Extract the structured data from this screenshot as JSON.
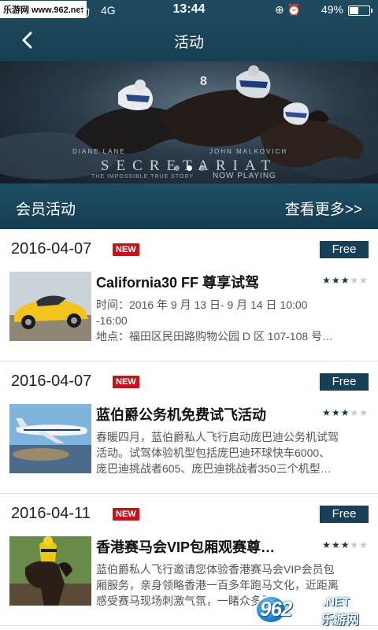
{
  "status_bar": {
    "watermark": "乐游网 www.962.net",
    "carrier": "动",
    "network": "4G",
    "time": "13:44",
    "icons": "⊕ ⏰",
    "battery": "49%",
    "battery_level": 0.49
  },
  "nav": {
    "back_icon": "chevron-left-icon",
    "title": "活动"
  },
  "banner": {
    "credit_left": "DIANE LANE",
    "credit_right": "JOHN MALKOVICH",
    "movie_title": "SECRETARIAT",
    "tagline": "THE IMPOSSIBLE TRUE STORY",
    "now_playing": "NOW PLAYING",
    "page_count": 3,
    "active_page": 2
  },
  "section": {
    "label": "会员活动",
    "more": "查看更多>>"
  },
  "activities": [
    {
      "date": "2016-04-07",
      "new_badge": "NEW",
      "price": "Free",
      "name": "California30 FF 尊享试驾",
      "rating": 3,
      "rating_max": 5,
      "desc_lines": [
        "时间：2016 年 9 月 13 日- 9 月 14 日    10:00",
        "-16:00",
        "地点：福田区民田路购物公园 D 区 107-108 号…"
      ],
      "thumb": "yellow-sports-car"
    },
    {
      "date": "2016-04-07",
      "new_badge": "NEW",
      "price": "Free",
      "name": "蓝伯爵公务机免费试飞活动",
      "rating": 3,
      "rating_max": 5,
      "desc_lines": [
        "春暖四月，蓝伯爵私人飞行启动庞巴迪公务机试驾",
        "活动。试驾体验机型包括庞巴迪环球快车6000、",
        "庞巴迪挑战者605、庞巴迪挑战者350三个机型…"
      ],
      "thumb": "private-jet"
    },
    {
      "date": "2016-04-11",
      "new_badge": "NEW",
      "price": "Free",
      "name": "香港赛马会VIP包厢观赛尊…",
      "rating": 3,
      "rating_max": 5,
      "desc_lines": [
        "蓝伯爵私人飞行邀请您体验香港赛马会VIP会员包",
        "厢服务，亲身领略香港一百多年跑马文化，近距离",
        "感受赛马现场刺激气氛，一睹众多马……"
      ],
      "thumb": "racehorse-jockey"
    }
  ],
  "site_watermark": {
    "number": "962",
    "suffix": ".NET",
    "name": "乐游网"
  }
}
